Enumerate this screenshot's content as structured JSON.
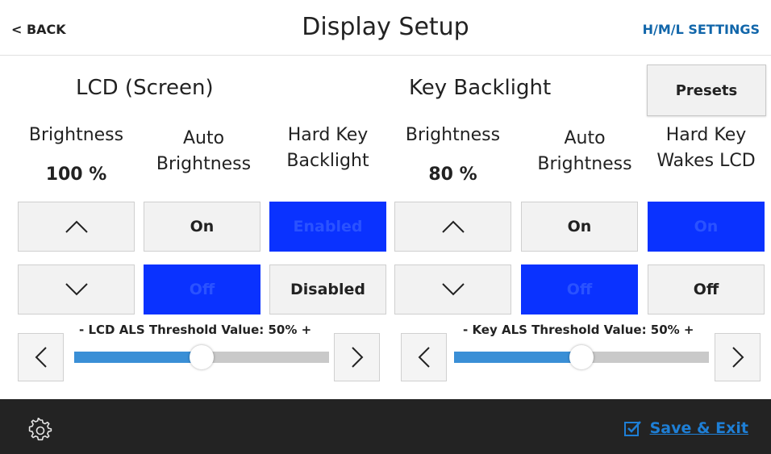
{
  "header": {
    "back_label": "< BACK",
    "title": "Display Setup",
    "hml_label": "H/M/L SETTINGS"
  },
  "lcd": {
    "title": "LCD (Screen)",
    "brightness_label": "Brightness",
    "brightness_value": "100 %",
    "auto_label": "Auto\nBrightness",
    "hardkey_label": "Hard Key\nBacklight",
    "auto_on": "On",
    "auto_off": "Off",
    "hardkey_enabled": "Enabled",
    "hardkey_disabled": "Disabled",
    "als_label": "-  LCD ALS Threshold Value: 50%  +",
    "als_level": 0.5
  },
  "key": {
    "title": "Key Backlight",
    "presets_label": "Presets",
    "brightness_label": "Brightness",
    "brightness_value": "80 %",
    "auto_label": "Auto\nBrightness",
    "wakes_label": "Hard Key\nWakes LCD",
    "auto_on": "On",
    "auto_off": "Off",
    "wakes_on": "On",
    "wakes_off": "Off",
    "als_label": "-  Key ALS Threshold Value: 50%  +",
    "als_level": 0.5
  },
  "footer": {
    "save_label": "Save & Exit"
  },
  "colors": {
    "active": "#0a32ff",
    "link": "#1e7fd6",
    "footer_bg": "#232323"
  },
  "icons": {
    "footer_left": "gear-icon",
    "save": "checkbox-icon"
  }
}
